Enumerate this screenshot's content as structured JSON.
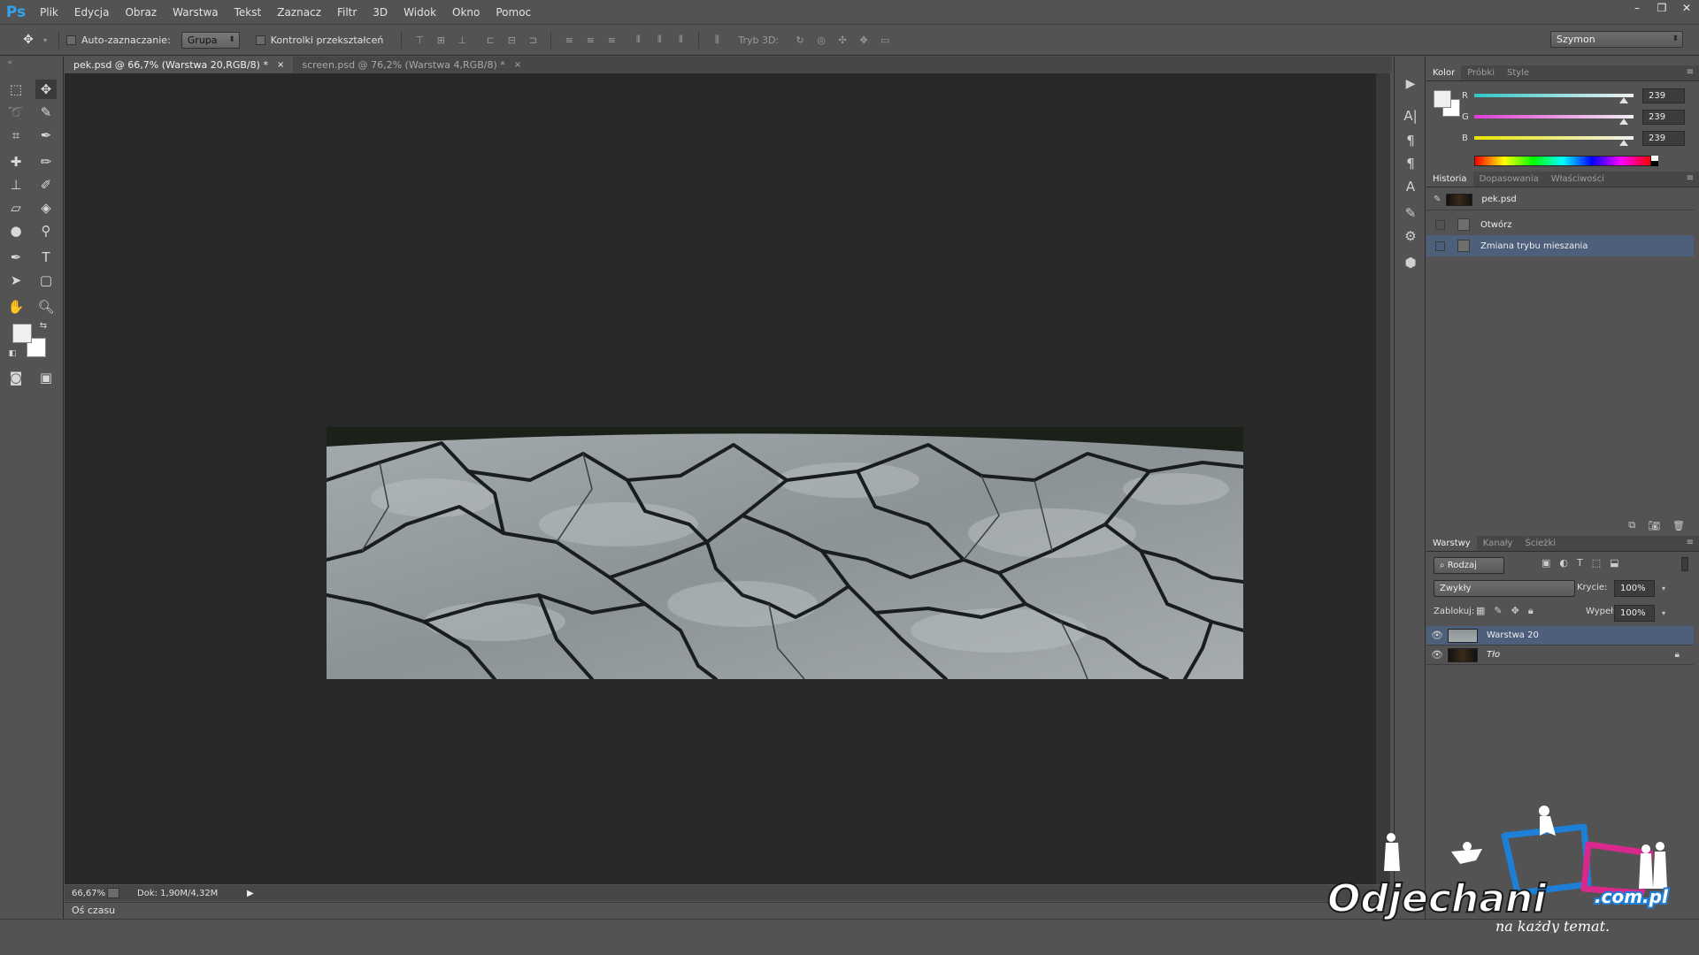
{
  "app": {
    "logo": "Ps"
  },
  "menu": [
    "Plik",
    "Edycja",
    "Obraz",
    "Warstwa",
    "Tekst",
    "Zaznacz",
    "Filtr",
    "3D",
    "Widok",
    "Okno",
    "Pomoc"
  ],
  "window_controls": [
    "–",
    "❐",
    "✕"
  ],
  "options": {
    "auto_select_label": "Auto-zaznaczanie:",
    "auto_select_value": "Grupa",
    "transform_controls_label": "Kontrolki przekształceń",
    "mode3d_label": "Tryb 3D:",
    "workspace": "Szymon"
  },
  "doc_tabs": [
    {
      "label": "pek.psd @ 66,7% (Warstwa 20,RGB/8) *",
      "close": "×"
    },
    {
      "label": "screen.psd @ 76,2% (Warstwa 4,RGB/8) *",
      "close": "×"
    }
  ],
  "status": {
    "zoom": "66,67%",
    "doc_info": "Dok: 1,90M/4,32M",
    "timeline": "Oś czasu"
  },
  "color_panel": {
    "tabs": [
      "Kolor",
      "Próbki",
      "Style"
    ],
    "channels": [
      {
        "label": "R",
        "value": "239",
        "fraction": 0.937,
        "gradient_start": "#2cc6c6",
        "gradient_end": "#f0f0f0"
      },
      {
        "label": "G",
        "value": "239",
        "fraction": 0.937,
        "gradient_start": "#e03ad8",
        "gradient_end": "#f0f0f0"
      },
      {
        "label": "B",
        "value": "239",
        "fraction": 0.937,
        "gradient_start": "#e8e600",
        "gradient_end": "#f0f0f0"
      }
    ],
    "foreground": "#efefef",
    "background": "#ffffff"
  },
  "history_panel": {
    "tabs": [
      "Historia",
      "Dopasowania",
      "Właściwości"
    ],
    "snapshot": "pek.psd",
    "steps": [
      "Otwórz",
      "Zmiana trybu mieszania"
    ]
  },
  "layers_panel": {
    "tabs": [
      "Warstwy",
      "Kanały",
      "Ścieżki"
    ],
    "filter": "Rodzaj",
    "blend_mode": "Zwykły",
    "opacity_label": "Krycie:",
    "opacity": "100%",
    "lock_label": "Zablokuj:",
    "fill_label": "Wypełnienie:",
    "fill": "100%",
    "layers": [
      "Warstwa 20",
      "Tło"
    ]
  },
  "watermark": {
    "brand": "Odjechani",
    "domain": ".com.pl",
    "tagline": "na każdy temat."
  },
  "colors": {
    "accent": "#2fa3f2",
    "selection": "#4d5f7a",
    "canvas": "#282828",
    "panel": "#535353"
  }
}
